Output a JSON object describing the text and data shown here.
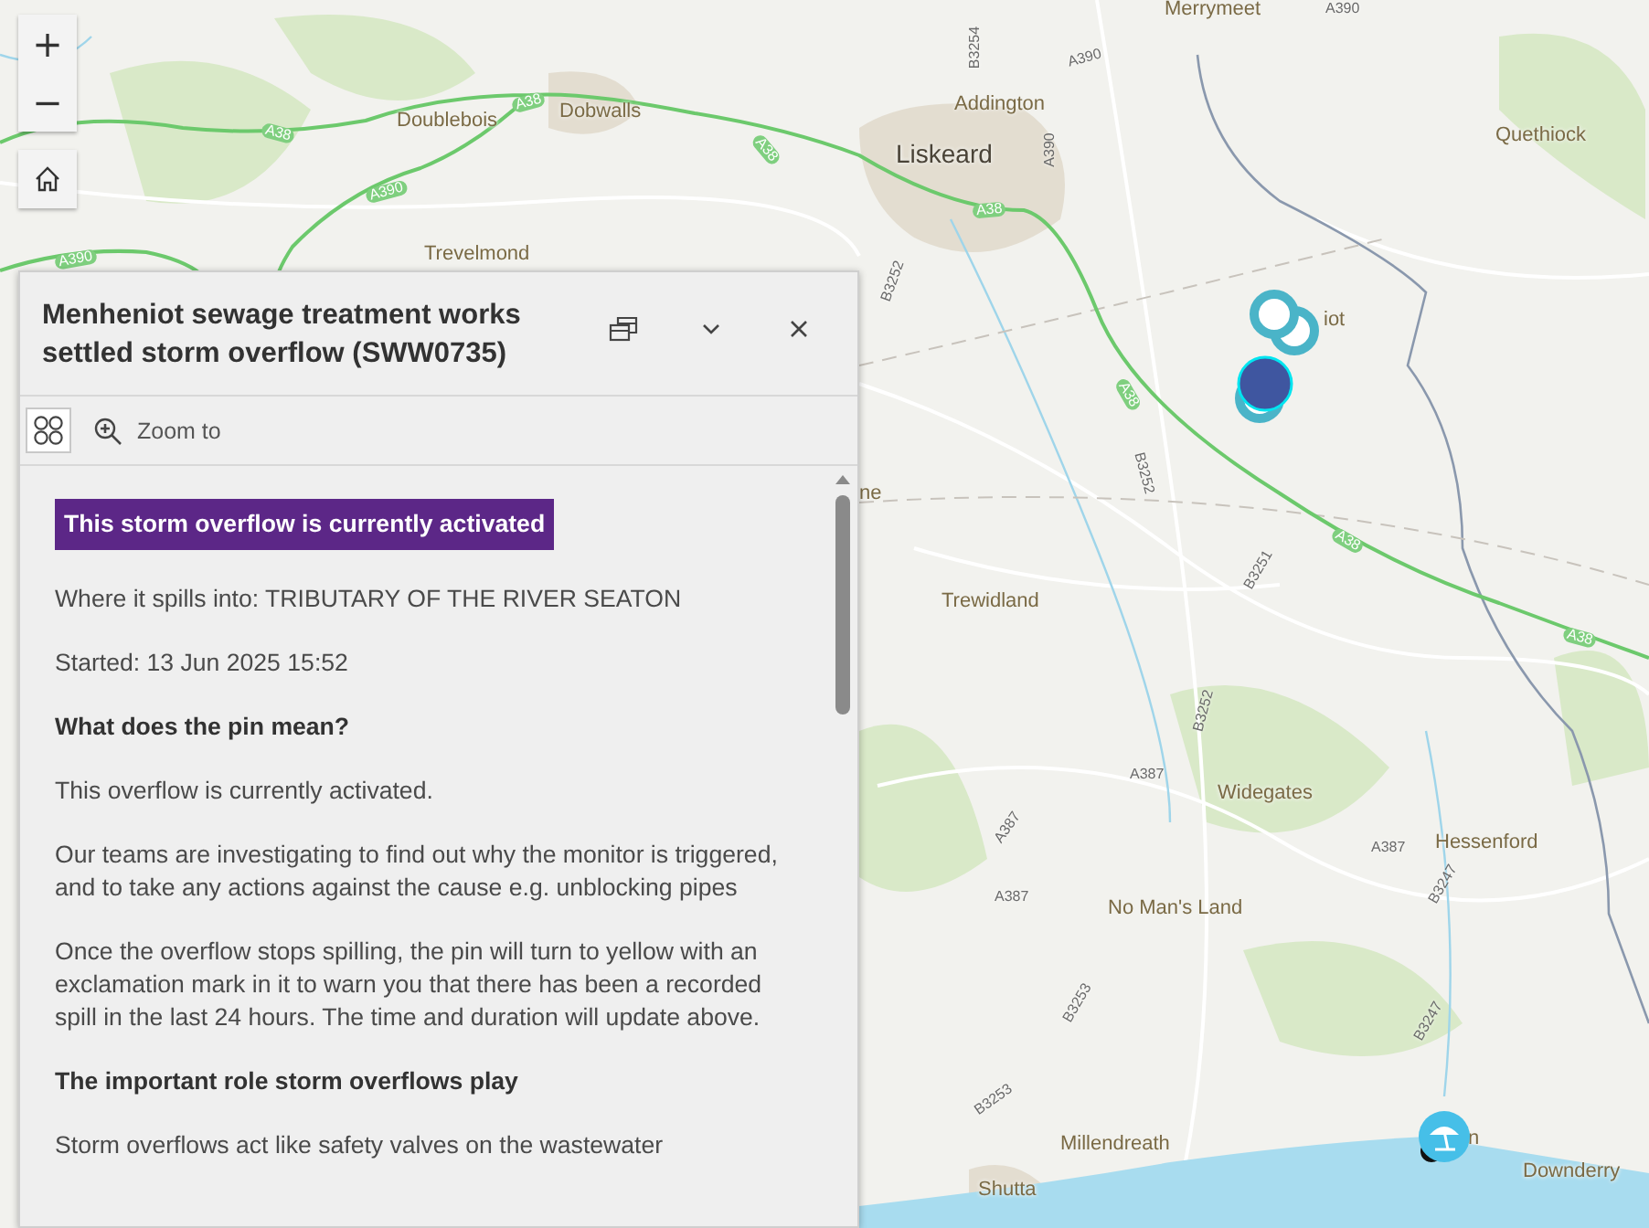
{
  "map_controls": [
    {
      "kind": "zoom_in",
      "label": "+"
    },
    {
      "kind": "zoom_out",
      "label": "−"
    },
    {
      "kind": "home"
    }
  ],
  "map": {
    "place_labels": [
      {
        "text": "Merrymeet",
        "kind": "village"
      },
      {
        "text": "Addington",
        "kind": "village"
      },
      {
        "text": "Liskeard",
        "kind": "town"
      },
      {
        "text": "Quethiock",
        "kind": "village"
      },
      {
        "text": "Doublebois",
        "kind": "village"
      },
      {
        "text": "Dobwalls",
        "kind": "village"
      },
      {
        "text": "Trevelmond",
        "kind": "village"
      },
      {
        "text": "iot",
        "kind": "village"
      },
      {
        "text": "ne",
        "kind": "village"
      },
      {
        "text": "Trewidland",
        "kind": "village"
      },
      {
        "text": "Widegates",
        "kind": "village"
      },
      {
        "text": "Hessenford",
        "kind": "village"
      },
      {
        "text": "No Man's Land",
        "kind": "village"
      },
      {
        "text": "Millendreath",
        "kind": "village"
      },
      {
        "text": "Shutta",
        "kind": "village"
      },
      {
        "text": "n",
        "kind": "village"
      },
      {
        "text": "Downderry",
        "kind": "village"
      }
    ],
    "road_labels": [
      {
        "text": "A38",
        "kind": "trunk"
      },
      {
        "text": "A38",
        "kind": "trunk"
      },
      {
        "text": "A38",
        "kind": "trunk"
      },
      {
        "text": "A38",
        "kind": "trunk"
      },
      {
        "text": "A38",
        "kind": "trunk"
      },
      {
        "text": "A38",
        "kind": "trunk"
      },
      {
        "text": "A38",
        "kind": "trunk"
      },
      {
        "text": "A390",
        "kind": "trunk"
      },
      {
        "text": "A390",
        "kind": "trunk"
      },
      {
        "text": "A390",
        "kind": "minor"
      },
      {
        "text": "A390",
        "kind": "minor"
      },
      {
        "text": "B3254",
        "kind": "minor"
      },
      {
        "text": "A390",
        "kind": "minor"
      },
      {
        "text": "B3252",
        "kind": "minor"
      },
      {
        "text": "B3251",
        "kind": "minor"
      },
      {
        "text": "B3252",
        "kind": "minor"
      },
      {
        "text": "A387",
        "kind": "minor"
      },
      {
        "text": "B3252",
        "kind": "minor"
      },
      {
        "text": "A387",
        "kind": "minor"
      },
      {
        "text": "A387",
        "kind": "minor"
      },
      {
        "text": "B3247",
        "kind": "minor"
      },
      {
        "text": "B3253",
        "kind": "minor"
      },
      {
        "text": "B3247",
        "kind": "minor"
      },
      {
        "text": "B3253",
        "kind": "minor"
      },
      {
        "text": "A387",
        "kind": "minor"
      }
    ],
    "markers": [
      {
        "kind": "ring"
      },
      {
        "kind": "ring"
      },
      {
        "kind": "ring"
      },
      {
        "kind": "filled"
      },
      {
        "kind": "dark"
      },
      {
        "kind": "beach"
      }
    ]
  },
  "popup": {
    "title": "Menheniot sewage treatment works settled storm overflow (SWW0735)",
    "actions": [
      {
        "label": "Zoom to"
      }
    ],
    "badge": "This storm overflow is currently activated",
    "content": [
      {
        "kind": "text",
        "text": "Where it spills into: TRIBUTARY OF THE RIVER SEATON"
      },
      {
        "kind": "text",
        "text": "Started: 13 Jun 2025 15:52"
      },
      {
        "kind": "heading",
        "text": "What does the pin mean?"
      },
      {
        "kind": "text",
        "text": "This overflow is currently activated."
      },
      {
        "kind": "text",
        "text": "Our teams are investigating to find out why the monitor is triggered, and to take any actions against the cause e.g. unblocking pipes"
      },
      {
        "kind": "text",
        "text": "Once the overflow stops spilling, the pin will turn to yellow with an exclamation mark in it to warn you that there has been a recorded spill in the last 24 hours. The time and duration will update above."
      },
      {
        "kind": "heading",
        "text": "The important role storm overflows play"
      },
      {
        "kind": "text",
        "text": "Storm overflows act like safety valves on the wastewater"
      }
    ]
  }
}
